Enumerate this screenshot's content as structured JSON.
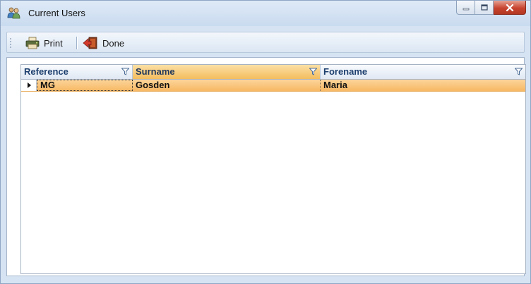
{
  "window": {
    "title": "Current Users",
    "icon": "users-icon",
    "controls": [
      "minimize-icon",
      "maximize-icon",
      "close-icon"
    ]
  },
  "toolbar": {
    "print_label": "Print",
    "print_icon": "printer-icon",
    "done_label": "Done",
    "done_icon": "exit-door-icon"
  },
  "grid": {
    "columns": [
      {
        "label": "Reference",
        "sorted": false
      },
      {
        "label": "Surname",
        "sorted": true
      },
      {
        "label": "Forename",
        "sorted": false
      }
    ],
    "rows": [
      {
        "reference": "MG",
        "surname": "Gosden",
        "forename": "Maria",
        "selected": true
      }
    ]
  },
  "colors": {
    "selection": "#f7b864",
    "sorted_header": "#f4bd5e",
    "header_text": "#1d3f6e"
  }
}
